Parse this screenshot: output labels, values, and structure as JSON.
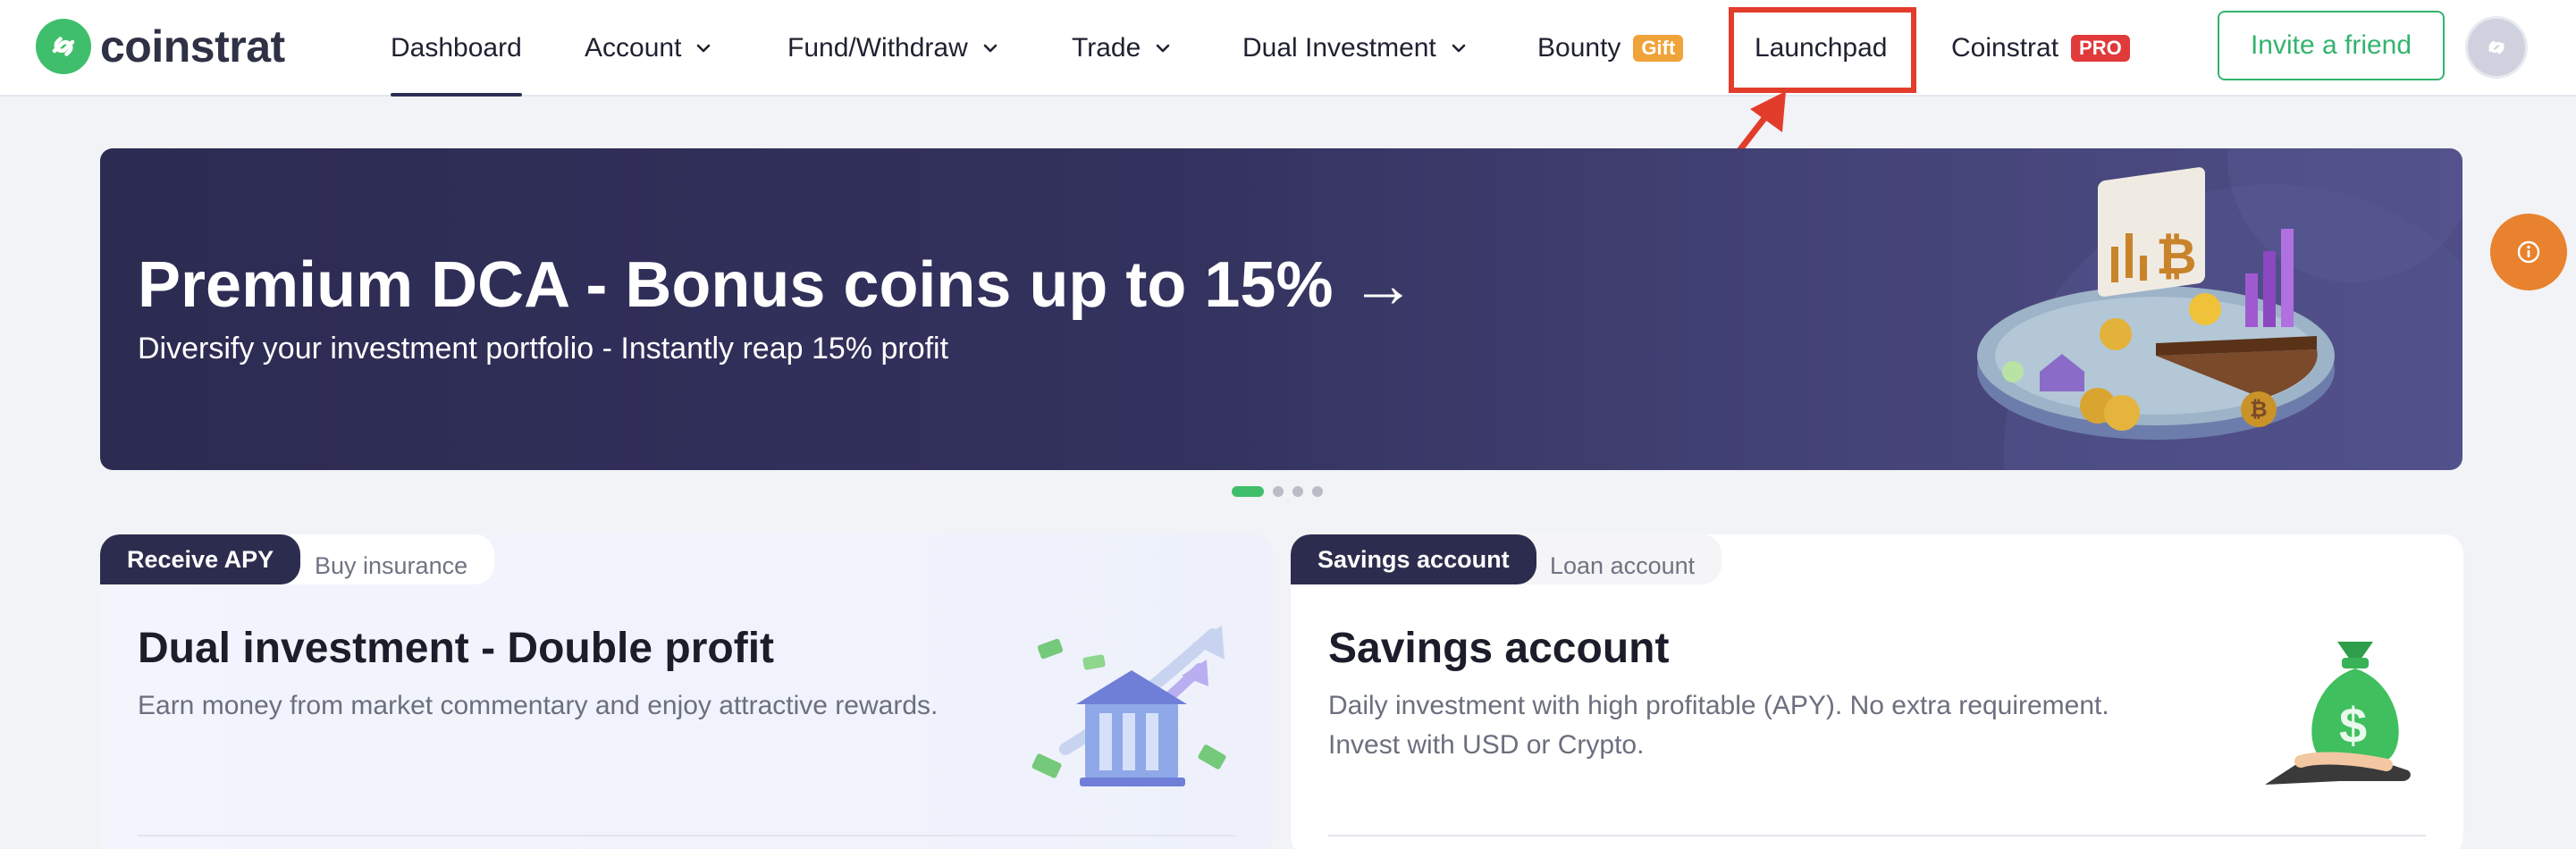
{
  "brand": {
    "name": "coinstrat"
  },
  "nav": {
    "dashboard": "Dashboard",
    "account": "Account",
    "fund_withdraw": "Fund/Withdraw",
    "trade": "Trade",
    "dual_investment": "Dual Investment",
    "bounty": "Bounty",
    "bounty_badge": "Gift",
    "launchpad": "Launchpad",
    "coinstrat": "Coinstrat",
    "coinstrat_badge": "PRO",
    "active": "Dashboard"
  },
  "header": {
    "invite_label": "Invite a friend"
  },
  "banner": {
    "title": "Premium DCA - Bonus coins up to 15% →",
    "subtitle": "Diversify your investment portfolio - Instantly reap 15% profit",
    "slide_count": 4,
    "active_slide": 1
  },
  "cards": {
    "left": {
      "tab_active": "Receive APY",
      "tab_inactive": "Buy insurance",
      "title": "Dual investment - Double profit",
      "description": "Earn money from market commentary and enjoy attractive rewards."
    },
    "right": {
      "tab_active": "Savings account",
      "tab_inactive": "Loan account",
      "title": "Savings account",
      "description": "Daily investment with high profitable (APY). No extra requirement. Invest with USD or Crypto."
    }
  },
  "colors": {
    "accent_green": "#34b36e",
    "highlight_red": "#e23c2b",
    "banner_navy": "#2c2b52",
    "info_orange": "#e9822e"
  },
  "icons": {
    "logo": "coinstrat-logo-icon",
    "chevron": "chevron-down-icon",
    "info": "info-icon",
    "avatar": "user-avatar-icon"
  }
}
